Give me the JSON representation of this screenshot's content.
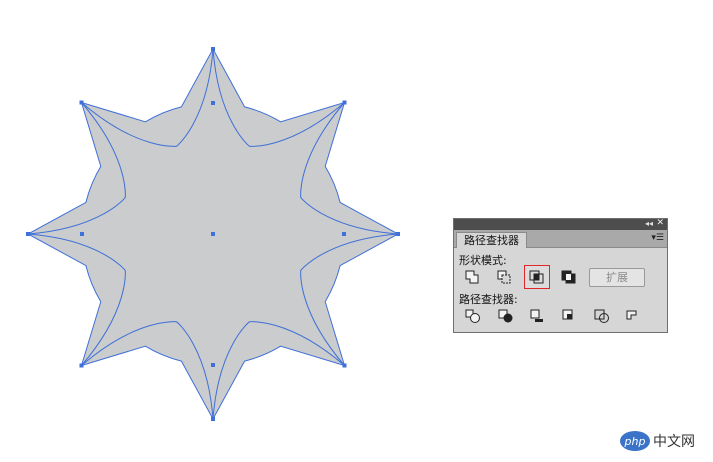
{
  "artwork": {
    "fill_color": "#cacccd",
    "stroke_color": "#3f6fd8",
    "anchor_color": "#3f6fd8"
  },
  "panel": {
    "tab_label": "路径查找器",
    "shape_modes_label": "形状模式:",
    "pathfinders_label": "路径查找器:",
    "expand_label": "扩展",
    "collapse_icon": "double-arrow-left-icon",
    "close_icon": "close-icon",
    "menu_icon": "panel-menu-icon",
    "shape_mode_buttons": [
      "unite",
      "minus-front",
      "intersect",
      "exclude"
    ],
    "selected_shape_mode": "intersect",
    "pathfinder_buttons": [
      "divide",
      "trim",
      "merge",
      "crop",
      "outline",
      "minus-back"
    ],
    "accent_selected": "#e0262b"
  },
  "watermark": {
    "logo_text": "php",
    "site_text": "中文网"
  }
}
